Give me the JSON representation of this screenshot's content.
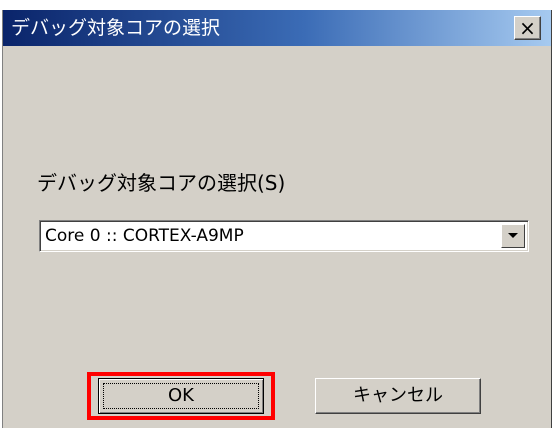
{
  "dialog": {
    "title": "デバッグ対象コアの選択",
    "close_glyph": "×",
    "field_label": "デバッグ対象コアの選択(S)",
    "core_select": {
      "value": "Core 0 :: CORTEX-A9MP"
    },
    "ok_label": "OK",
    "cancel_label": "キャンセル"
  },
  "colors": {
    "highlight": "#ff0000",
    "title_bar_start": "#0a246a",
    "title_bar_end": "#a6caf0",
    "dialog_face": "#d4d0c8"
  }
}
